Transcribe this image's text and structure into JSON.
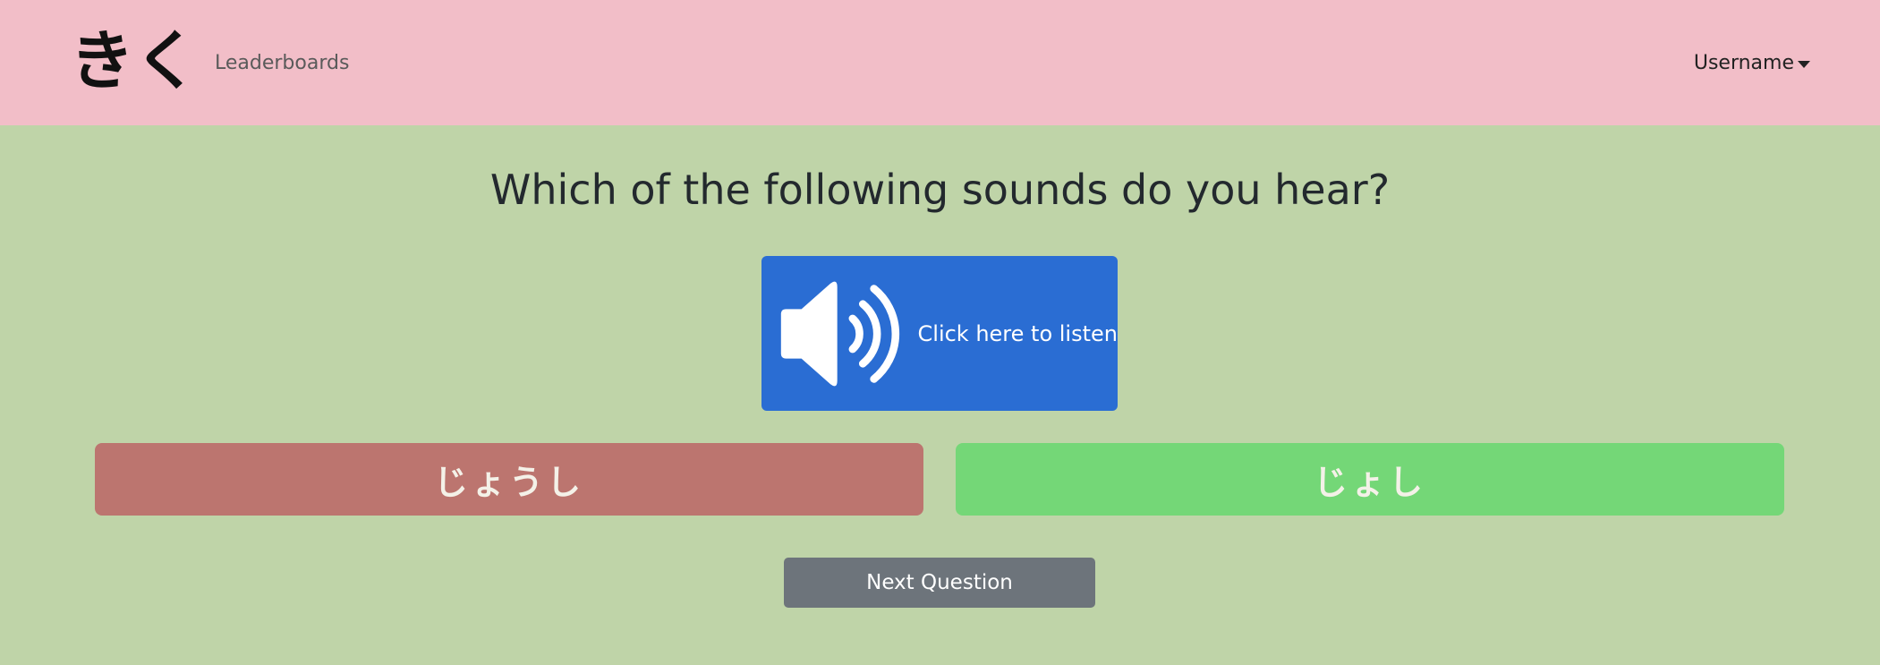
{
  "navbar": {
    "brand": "きく",
    "links": [
      {
        "label": "Leaderboards"
      }
    ],
    "user_menu": {
      "label": "Username",
      "icon": "caret-down-icon"
    },
    "background": "#f2bec8"
  },
  "main": {
    "question": "Which of the following sounds do you hear?",
    "listen_button": {
      "label": "Click here to listen",
      "icon": "speaker-icon",
      "color": "#2a6dd3"
    },
    "answers": [
      {
        "label": "じょうし",
        "state": "incorrect",
        "color": "#bc756f"
      },
      {
        "label": "じょし",
        "state": "correct",
        "color": "#74d777"
      }
    ],
    "next_button": {
      "label": "Next Question",
      "color": "#6d747b"
    },
    "background": "#bfd4a8"
  }
}
